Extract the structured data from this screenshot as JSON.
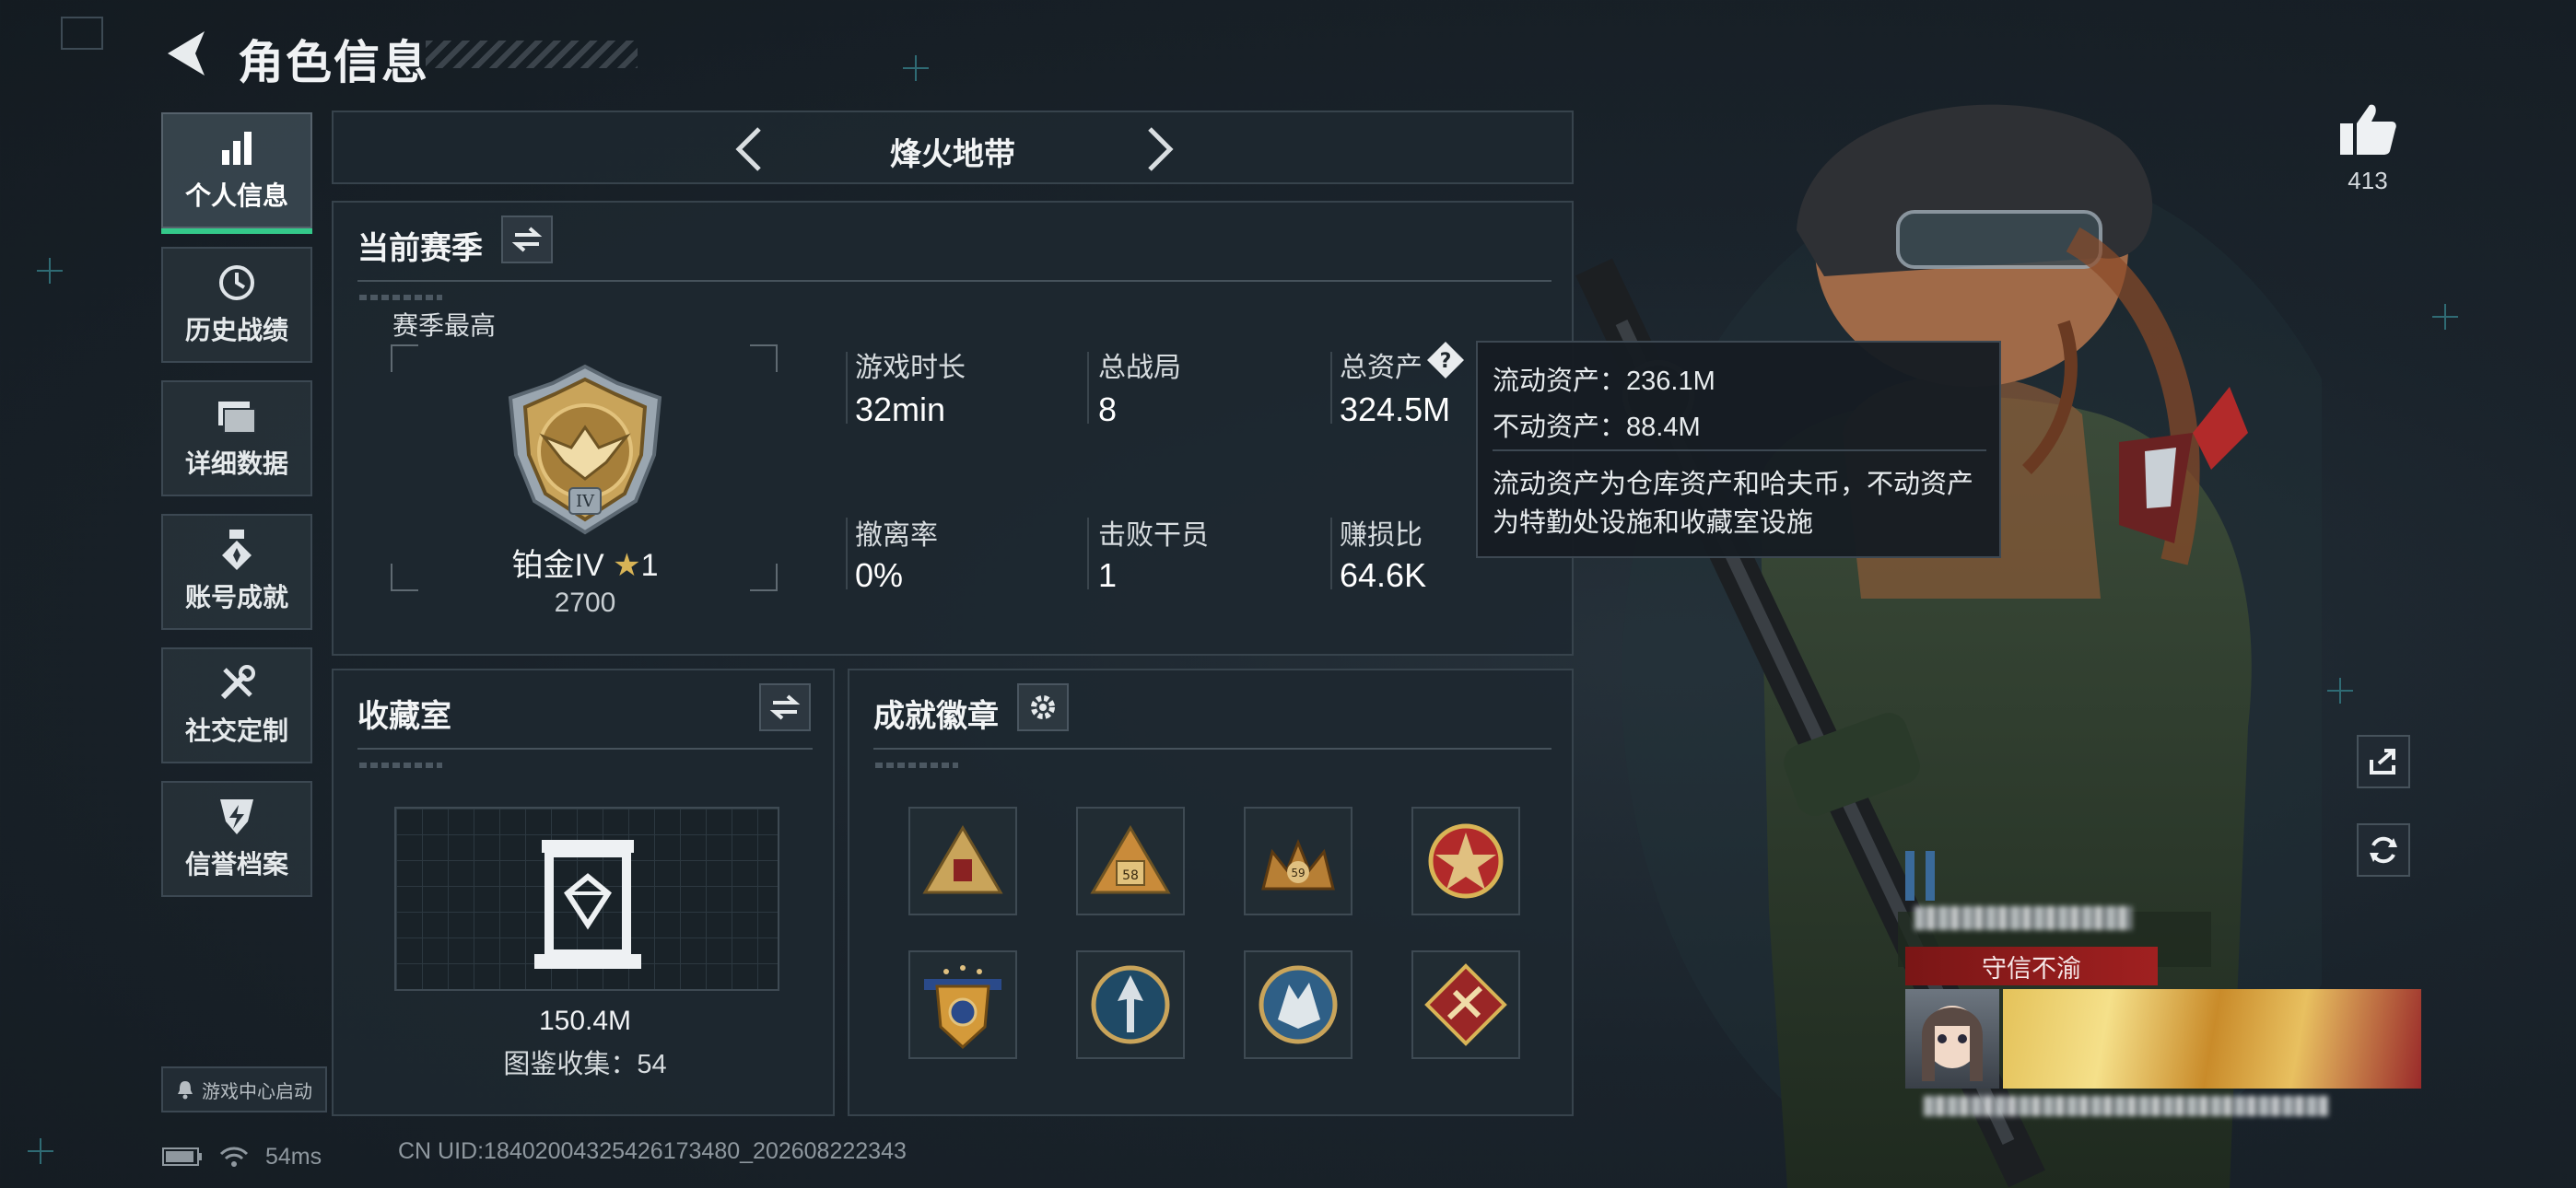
{
  "header": {
    "title": "角色信息"
  },
  "sidebar": {
    "items": [
      {
        "label": "个人信息",
        "icon": "bar-chart-icon",
        "active": true
      },
      {
        "label": "历史战绩",
        "icon": "history-clock-icon"
      },
      {
        "label": "详细数据",
        "icon": "folder-icon"
      },
      {
        "label": "账号成就",
        "icon": "medal-icon"
      },
      {
        "label": "社交定制",
        "icon": "tools-icon"
      },
      {
        "label": "信誉档案",
        "icon": "shield-lightning-icon"
      }
    ],
    "game_center": "游戏中心启动"
  },
  "mode": {
    "title": "烽火地带"
  },
  "season": {
    "head": "当前赛季",
    "best_label": "赛季最高",
    "rank_name": "铂金IV",
    "rank_stars": "1",
    "rank_score": "2700",
    "stats": [
      {
        "label": "游戏时长",
        "value": "32min"
      },
      {
        "label": "总战局",
        "value": "8"
      },
      {
        "label": "总资产",
        "value": "324.5M"
      },
      {
        "label": "撤离率",
        "value": "0%"
      },
      {
        "label": "击败干员",
        "value": "1"
      },
      {
        "label": "赚损比",
        "value": "64.6K"
      }
    ]
  },
  "tooltip": {
    "liquid": "流动资产：236.1M",
    "fixed": "不动资产：88.4M",
    "desc_line1": "流动资产为仓库资产和哈夫币，不动资产",
    "desc_line2": "为特勤处设施和收藏室设施"
  },
  "collection": {
    "head": "收藏室",
    "value": "150.4M",
    "count": "图鉴收集：54"
  },
  "badges": {
    "head": "成就徽章",
    "items": [
      "badge-triangle-gold",
      "badge-triangle-58",
      "badge-crown-59",
      "badge-red-star",
      "badge-wings-shield",
      "badge-blue-arrow",
      "badge-wolf",
      "badge-red-diamond"
    ]
  },
  "profile": {
    "likes": "413",
    "honor": "守信不渝"
  },
  "status": {
    "ping": "54ms",
    "uid": "CN UID:18402004325426173480_202608222343"
  },
  "colors": {
    "accent": "#34c98a",
    "banner": "#a02020",
    "gold": "#c9a45a"
  }
}
